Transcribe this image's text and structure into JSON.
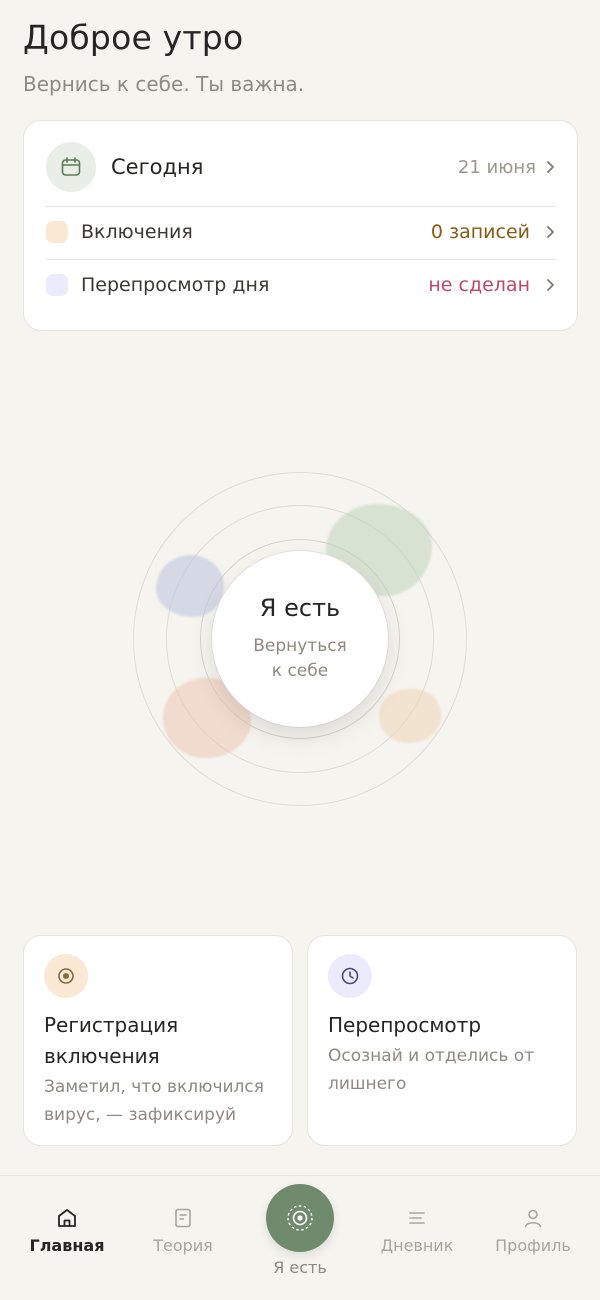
{
  "header": {
    "greeting": "Доброе утро",
    "subtitle": "Вернись к себе. Ты важна."
  },
  "today": {
    "title": "Сегодня",
    "date": "21 июня",
    "rows": [
      {
        "label": "Включения",
        "value": "0 записей",
        "value_color": "#8a5a10",
        "dot_color": "#fbe8d2"
      },
      {
        "label": "Перепросмотр дня",
        "value": "не сделан",
        "value_color": "#c2456a",
        "dot_color": "#ecebfb"
      }
    ]
  },
  "orb": {
    "title": "Я есть",
    "subtitle_line1": "Вернуться",
    "subtitle_line2": "к себе"
  },
  "cards": [
    {
      "title_line1": "Регистрация",
      "title_line2": "включения",
      "desc_line1": "Заметил, что включился",
      "desc_line2": "вирус, — зафиксируй",
      "icon": "target-icon",
      "icon_bg": "#fbe9d5"
    },
    {
      "title_line1": "Перепросмотр",
      "desc_line1": "Осознай и отделись от",
      "desc_line2": "лишнего",
      "icon": "clock-icon",
      "icon_bg": "#ecebfb"
    }
  ],
  "nav": {
    "home": "Главная",
    "theory": "Теория",
    "center": "Я есть",
    "diary": "Дневник",
    "profile": "Профиль"
  },
  "colors": {
    "accent_green": "#6f8a6d",
    "background": "#f6f4ef"
  }
}
